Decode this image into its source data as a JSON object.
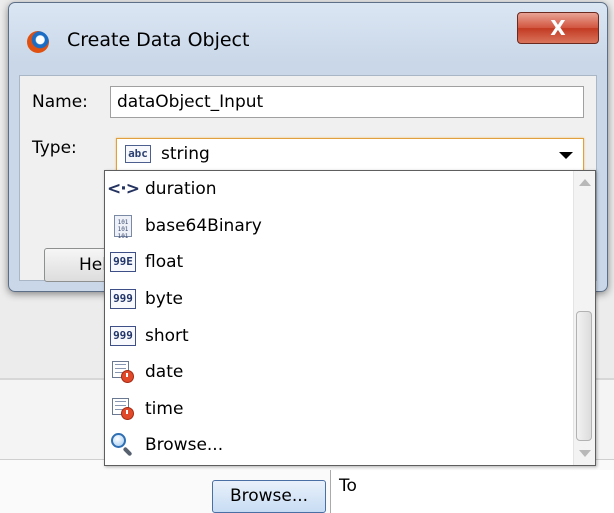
{
  "dialog": {
    "title": "Create Data Object",
    "close_label": "X",
    "name_label": "Name:",
    "name_value": "dataObject_Input",
    "type_label": "Type:",
    "type_badge": "abc",
    "type_value": "string",
    "help_label": "Help"
  },
  "dropdown": {
    "items": [
      {
        "label": "duration",
        "icon": "duration-icon",
        "glyph": "<·>"
      },
      {
        "label": "base64Binary",
        "icon": "binary-file-icon",
        "glyph": "101 101 101"
      },
      {
        "label": "float",
        "icon": "float-badge-icon",
        "glyph": "99E"
      },
      {
        "label": "byte",
        "icon": "number-badge-icon",
        "glyph": "999"
      },
      {
        "label": "short",
        "icon": "number-badge-icon",
        "glyph": "999"
      },
      {
        "label": "date",
        "icon": "calendar-clock-icon"
      },
      {
        "label": "time",
        "icon": "calendar-clock-icon"
      },
      {
        "label": "Browse...",
        "icon": "search-icon"
      }
    ]
  },
  "background": {
    "browse_label": "Browse...",
    "to_label": "To"
  },
  "colors": {
    "close_button": "#c9432b",
    "focus_border": "#e0a040",
    "title_gradient": "#c9d7e8"
  }
}
